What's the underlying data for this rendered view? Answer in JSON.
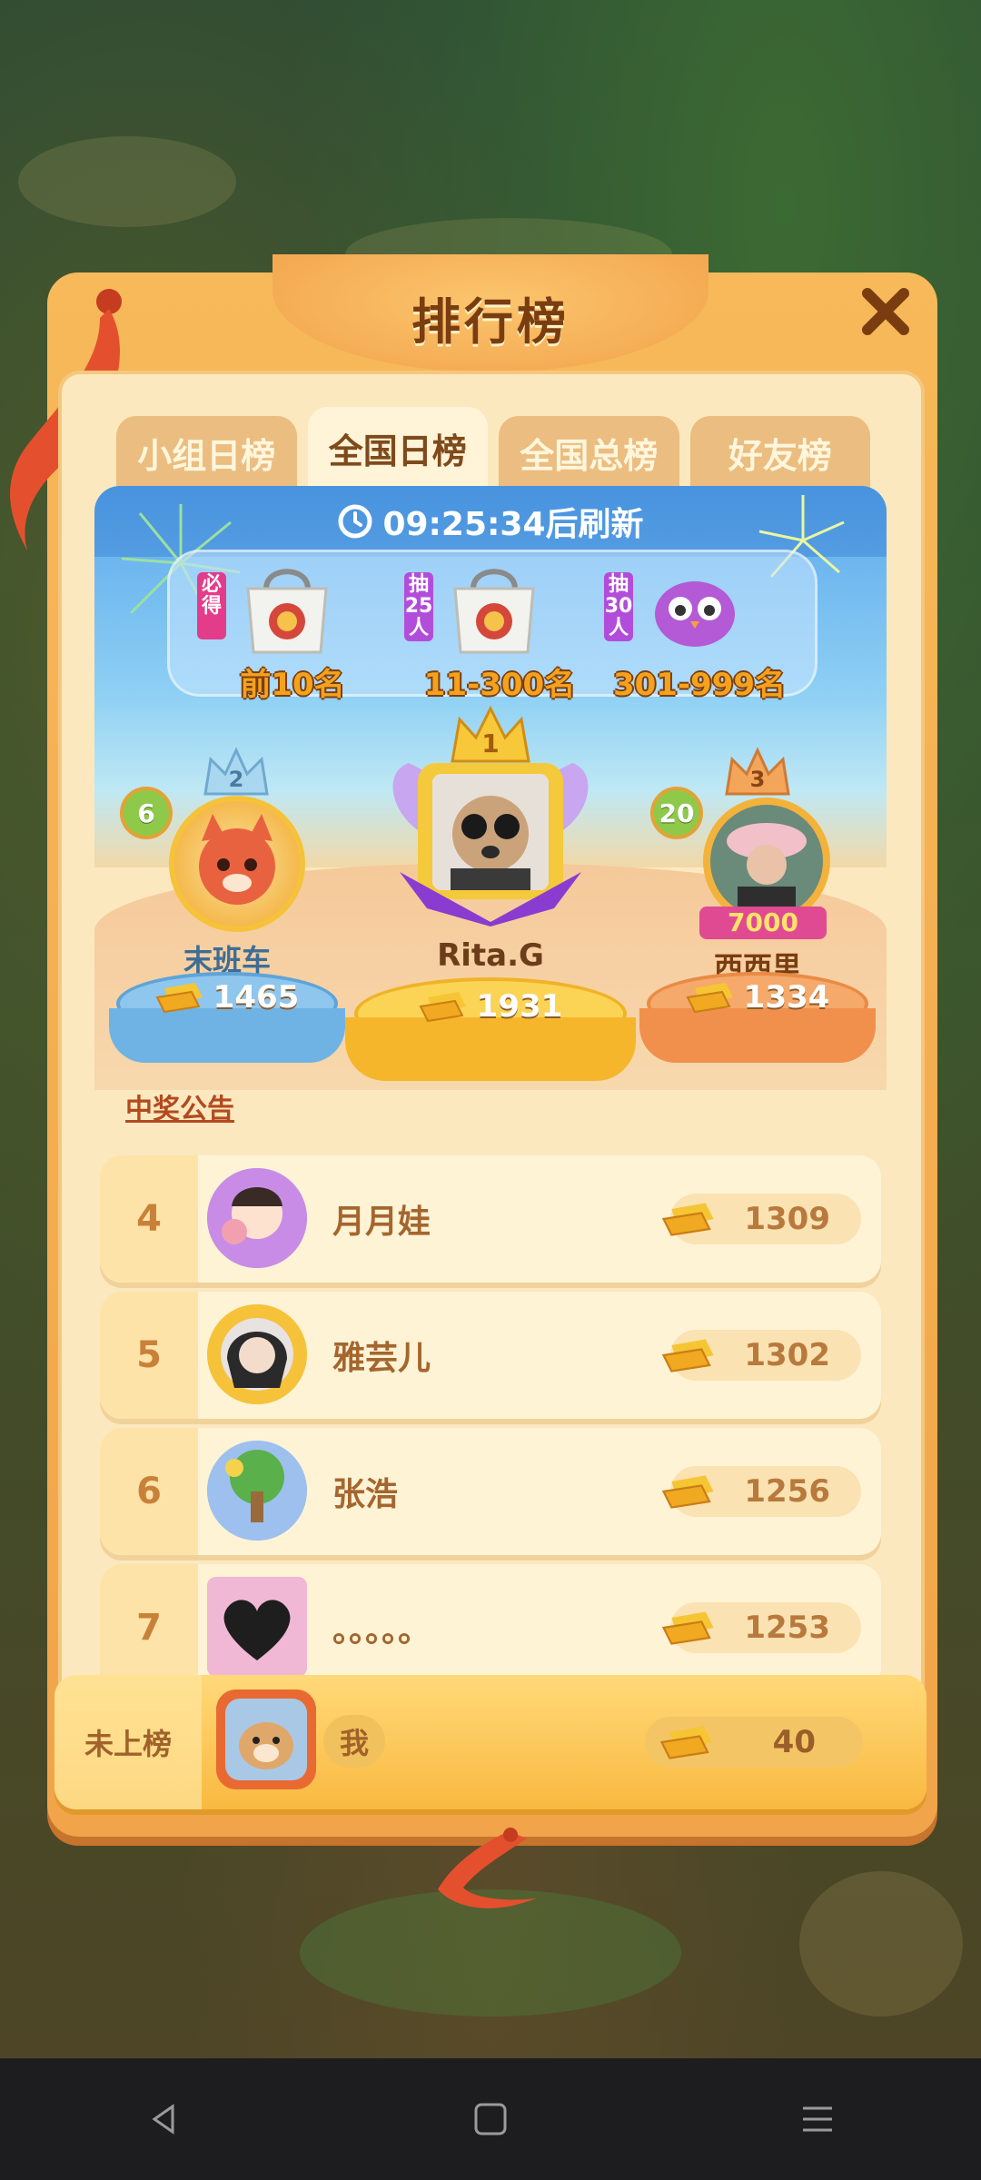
{
  "window": {
    "title": "排行榜"
  },
  "tabs": [
    {
      "label": "小组日榜",
      "active": false
    },
    {
      "label": "全国日榜",
      "active": true
    },
    {
      "label": "全国总榜",
      "active": false
    },
    {
      "label": "好友榜",
      "active": false
    }
  ],
  "refresh": {
    "time": "09:25:34",
    "suffix": "后刷新"
  },
  "rewards": [
    {
      "tag": "必得",
      "rank": "前10名",
      "prize_icon": "gift-bag-icon"
    },
    {
      "tag": "抽25人",
      "rank": "11-300名",
      "prize_icon": "gift-bag-icon"
    },
    {
      "tag": "抽30人",
      "rank": "301-999名",
      "prize_icon": "owl-plush-icon"
    }
  ],
  "podium": {
    "first": {
      "place": "1",
      "name": "Rita.G",
      "score": "1931"
    },
    "second": {
      "place": "2",
      "name": "末班车",
      "score": "1465",
      "level": "6"
    },
    "third": {
      "place": "3",
      "name": "西西里",
      "score": "1334",
      "level": "20",
      "frame_text": "7000"
    }
  },
  "announcement": "中奖公告",
  "ranking": [
    {
      "rank": "4",
      "name": "月月娃",
      "score": "1309"
    },
    {
      "rank": "5",
      "name": "雅芸儿",
      "score": "1302"
    },
    {
      "rank": "6",
      "name": "张浩",
      "score": "1256"
    },
    {
      "rank": "7",
      "name": "。。。。。",
      "score": "1253"
    }
  ],
  "me": {
    "rank": "未上榜",
    "name": "我",
    "score": "40"
  },
  "colors": {
    "gold": "#f4a21e",
    "panel": "#f7b95a",
    "banner": "#5aa8ec"
  }
}
